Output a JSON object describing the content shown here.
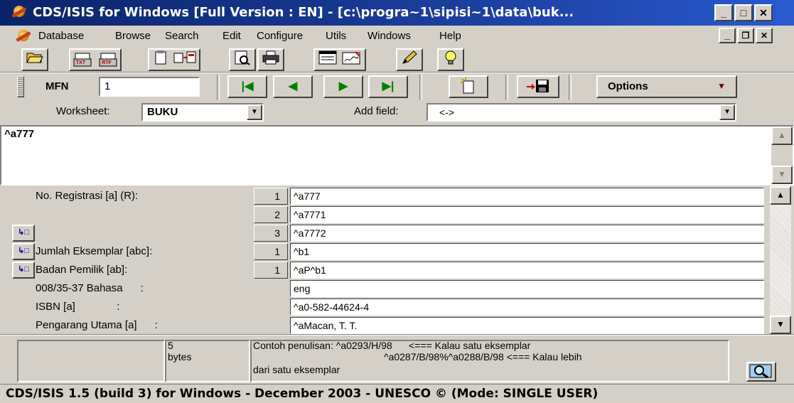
{
  "window": {
    "title": "CDS/ISIS for Windows [Full Version : EN] - [c:\\progra~1\\sipisi~1\\data\\buk...",
    "min": "_",
    "max": "□",
    "close": "✕",
    "child_min": "_",
    "child_restore": "❐",
    "child_close": "✕"
  },
  "menu": [
    "Database",
    "Browse",
    "Search",
    "Edit",
    "Configure",
    "Utils",
    "Windows",
    "Help"
  ],
  "toolbar_icons": [
    "open-folder-icon",
    "txt-export-icon",
    "rtf-export-icon",
    "clipboard-icon",
    "copy-record-icon",
    "preview-icon",
    "print-icon",
    "form-icon",
    "signature-icon",
    "pencil-icon",
    "lightbulb-icon"
  ],
  "toolbar": {
    "txt": "TXT",
    "rtf": "RTF"
  },
  "nav": {
    "mfn_label": "MFN",
    "mfn_value": "1",
    "first": "|◀",
    "prev": "◀",
    "next": "▶",
    "last": "▶|",
    "options_label": "Options",
    "options_arrow": "▼"
  },
  "worksheet": {
    "label": "Worksheet:",
    "value": "BUKU",
    "add_field_label": "Add field:",
    "add_field_value": "<->",
    "arrow": "▼"
  },
  "editor": {
    "text": "^a777"
  },
  "fields": [
    {
      "label": "No. Registrasi [a] (R):",
      "num": "1",
      "value": "^a777",
      "rep": false
    },
    {
      "label": "",
      "num": "2",
      "value": "^a7771",
      "rep": false
    },
    {
      "label": "",
      "num": "3",
      "value": "^a7772",
      "rep": true
    },
    {
      "label": "Jumlah Eksemplar [abc]:",
      "num": "1",
      "value": "^b1",
      "rep": true
    },
    {
      "label": "Badan Pemilik [ab]:",
      "num": "1",
      "value": "^aP^b1",
      "rep": true
    },
    {
      "label": "008/35-37 Bahasa      :",
      "num": "",
      "value": "eng",
      "rep": false
    },
    {
      "label": "ISBN [a]              :",
      "num": "",
      "value": "^a0-582-44624-4",
      "rep": false
    },
    {
      "label": "Pengarang Utama [a]      :",
      "num": "",
      "value": "^aMacan, T. T.",
      "rep": false
    }
  ],
  "rep_icon": "↳□",
  "status": {
    "bytes_count": "5",
    "bytes_label": "bytes",
    "hint_line1": "Contoh penulisan: ^a0293/H/98      <=== Kalau satu eksemplar",
    "hint_line2": "^a0287/B/98%^a0288/B/98 <=== Kalau lebih",
    "hint_line3": "dari satu eksemplar"
  },
  "footer": "CDS/ISIS 1.5 (build 3) for Windows - December 2003 - UNESCO © (Mode: SINGLE USER)"
}
